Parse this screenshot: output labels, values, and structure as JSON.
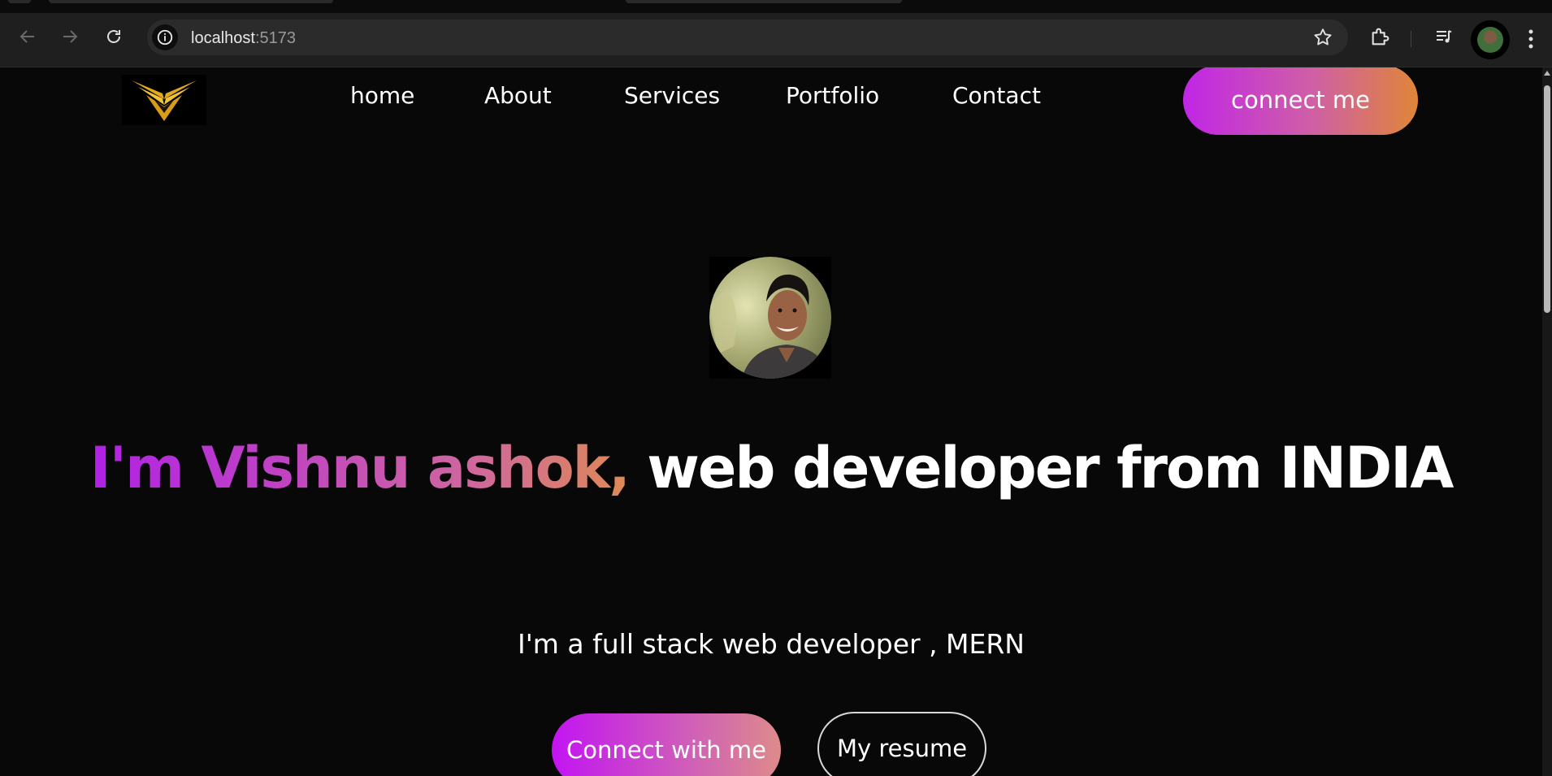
{
  "browser": {
    "url_host": "localhost",
    "url_port": ":5173"
  },
  "nav": {
    "links": [
      "home",
      "About",
      "Services",
      "Portfolio",
      "Contact"
    ],
    "cta_label": "connect me"
  },
  "hero": {
    "headline_name": "I'm Vishnu ashok,",
    "headline_rest": " web developer from INDIA",
    "tagline": "I'm a full stack web developer , MERN",
    "primary_button": "Connect with me",
    "secondary_button": "My resume"
  },
  "colors": {
    "page_bg": "#080808",
    "gradient_start": "#c026e6",
    "gradient_mid": "#cf5fa6",
    "gradient_end": "#df8638",
    "logo_gold": "#e7b425"
  },
  "icons": [
    "back-arrow-icon",
    "forward-arrow-icon",
    "reload-icon",
    "site-info-icon",
    "bookmark-star-icon",
    "extensions-puzzle-icon",
    "media-queue-icon",
    "profile-avatar",
    "more-menu-icon"
  ]
}
